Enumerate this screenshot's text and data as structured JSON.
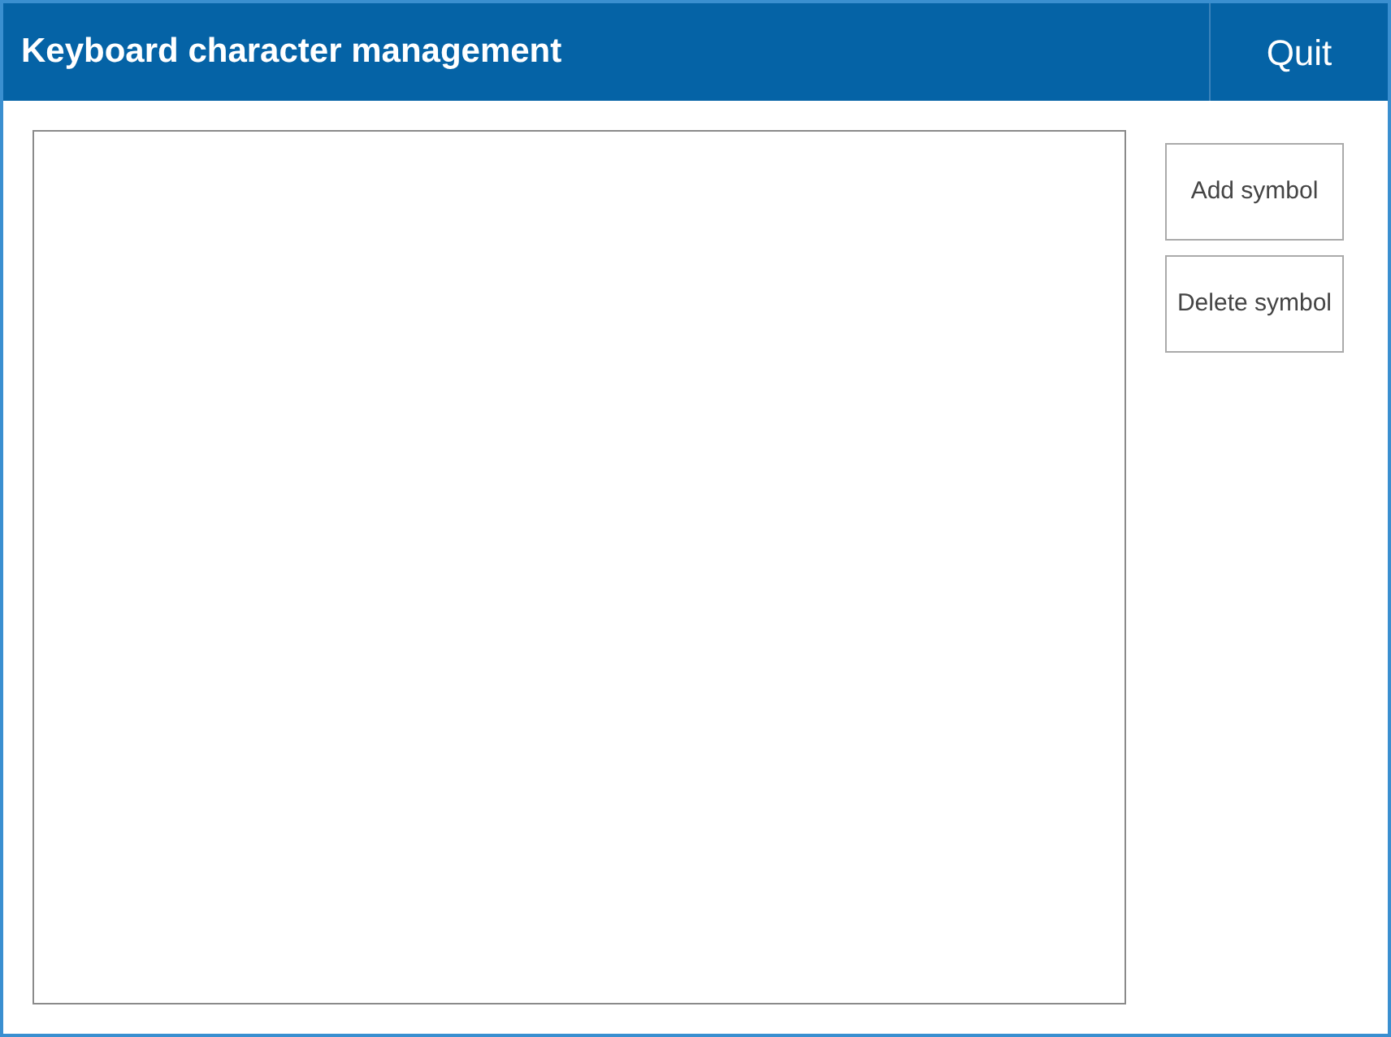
{
  "window": {
    "title": "Keyboard character management",
    "quit": "Quit"
  },
  "buttons": [
    "Add symbol",
    "Delete symbol"
  ]
}
